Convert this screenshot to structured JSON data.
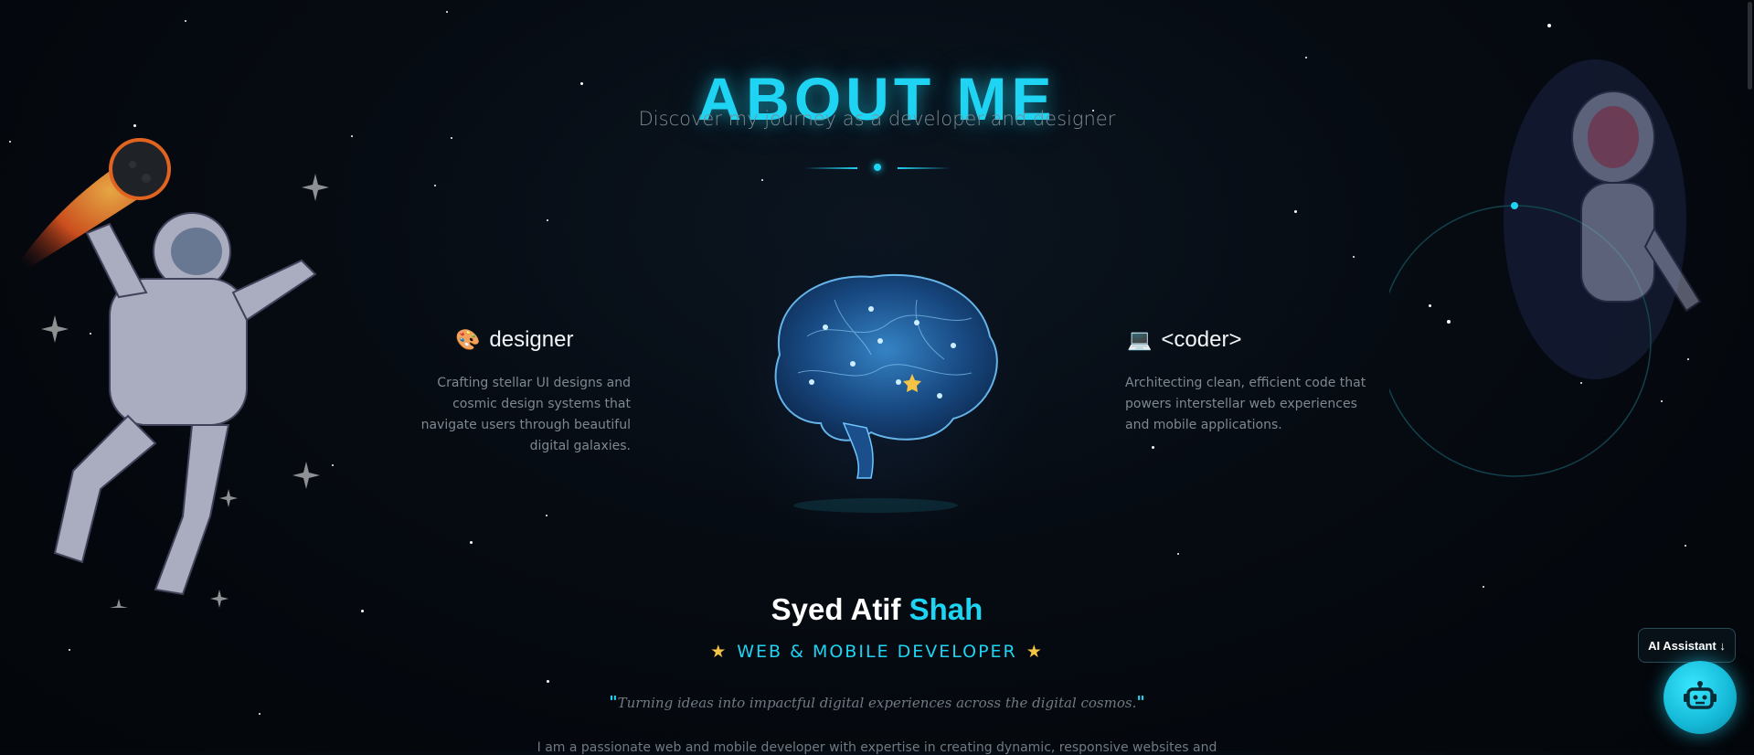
{
  "section": {
    "title": "ABOUT ME",
    "subtitle": "Discover my journey as a developer and designer"
  },
  "cards": {
    "designer": {
      "icon": "palette-icon",
      "title": "designer",
      "description": "Crafting stellar UI designs and cosmic design systems that navigate users through beautiful digital galaxies."
    },
    "coder": {
      "icon": "laptop-icon",
      "title": "<coder>",
      "description": "Architecting clean, efficient code that powers interstellar web experiences and mobile applications."
    }
  },
  "profile": {
    "first_name": "Syed Atif",
    "last_name": "Shah",
    "role": "WEB & MOBILE DEVELOPER",
    "quote_open": "\"",
    "quote": "Turning ideas into impactful digital experiences across the digital cosmos.",
    "quote_close": "\"",
    "intro": "I am a passionate web and mobile developer with expertise in creating dynamic, responsive websites and"
  },
  "assistant": {
    "label": "AI Assistant ↓",
    "icon": "robot-icon"
  },
  "colors": {
    "accent": "#1fd3f2",
    "star_icon": "#f6c445",
    "background": "#05090e"
  }
}
